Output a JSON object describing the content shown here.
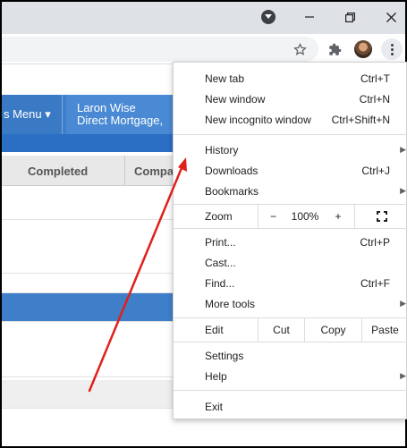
{
  "titlebar": {
    "icons": [
      "profile-dropdown-icon",
      "minimize-icon",
      "restore-icon",
      "close-icon"
    ]
  },
  "toolbar": {
    "icons": [
      "bookmark-star-icon",
      "extensions-icon",
      "avatar",
      "menu-dots-icon"
    ]
  },
  "page": {
    "nav_menu_label": "s Menu ▾",
    "nav_user_line1": "Laron Wise",
    "nav_user_line2": "Direct Mortgage,",
    "table_headers": [
      "Completed",
      "Compa"
    ]
  },
  "menu": {
    "new_tab": {
      "label": "New tab",
      "shortcut": "Ctrl+T"
    },
    "new_window": {
      "label": "New window",
      "shortcut": "Ctrl+N"
    },
    "new_incognito": {
      "label": "New incognito window",
      "shortcut": "Ctrl+Shift+N"
    },
    "history": {
      "label": "History"
    },
    "downloads": {
      "label": "Downloads",
      "shortcut": "Ctrl+J"
    },
    "bookmarks": {
      "label": "Bookmarks"
    },
    "zoom": {
      "label": "Zoom",
      "minus": "−",
      "value": "100%",
      "plus": "+"
    },
    "print": {
      "label": "Print...",
      "shortcut": "Ctrl+P"
    },
    "cast": {
      "label": "Cast..."
    },
    "find": {
      "label": "Find...",
      "shortcut": "Ctrl+F"
    },
    "more_tools": {
      "label": "More tools"
    },
    "edit": {
      "label": "Edit",
      "cut": "Cut",
      "copy": "Copy",
      "paste": "Paste"
    },
    "settings": {
      "label": "Settings"
    },
    "help": {
      "label": "Help"
    },
    "exit": {
      "label": "Exit"
    }
  },
  "colors": {
    "annotation_arrow": "#e0201b",
    "nav_blue": "#3f7fc9"
  }
}
